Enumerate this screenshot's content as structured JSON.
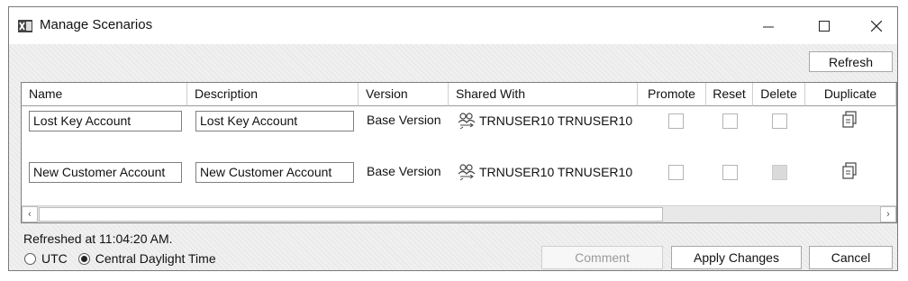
{
  "window": {
    "title": "Manage Scenarios",
    "app_icon": "excel-x-icon",
    "controls": [
      "minimize-icon",
      "maximize-icon",
      "close-icon"
    ]
  },
  "toolbar": {
    "refresh_label": "Refresh"
  },
  "grid": {
    "columns": [
      "Name",
      "Description",
      "Version",
      "Shared With",
      "Promote",
      "Reset",
      "Delete",
      "Duplicate"
    ],
    "rows": [
      {
        "name": "Lost Key Account",
        "description": "Lost Key Account",
        "version": "Base Version",
        "shared_with": "TRNUSER10 TRNUSER10",
        "promote": false,
        "reset": false,
        "delete": false,
        "delete_disabled": false
      },
      {
        "name": "New Customer Account",
        "description": "New Customer Account",
        "version": "Base Version",
        "shared_with": "TRNUSER10 TRNUSER10",
        "promote": false,
        "reset": false,
        "delete": false,
        "delete_disabled": true
      }
    ],
    "icons": {
      "shared": "users-share-icon",
      "duplicate": "duplicate-copy-icon"
    }
  },
  "status": {
    "refreshed_text": "Refreshed at 11:04:20 AM."
  },
  "timezone": {
    "options": [
      "UTC",
      "Central Daylight Time"
    ],
    "selected": "Central Daylight Time"
  },
  "footer": {
    "comment_label": "Comment",
    "apply_label": "Apply Changes",
    "cancel_label": "Cancel"
  }
}
